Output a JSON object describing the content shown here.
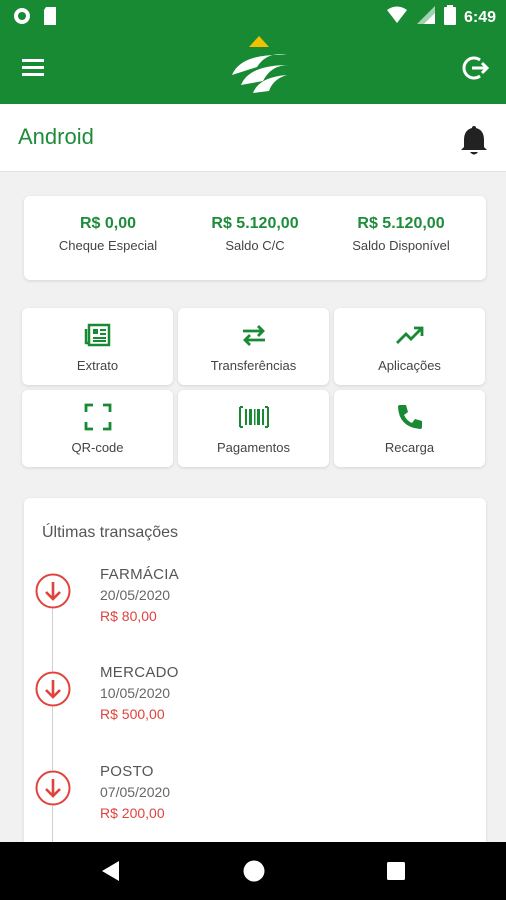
{
  "status_bar": {
    "time": "6:49",
    "icons": [
      "app-notification-icon",
      "sd-card-icon",
      "wifi-icon",
      "signal-icon",
      "battery-icon"
    ]
  },
  "app_bar": {
    "icons": [
      "menu-icon",
      "logo",
      "logout-icon"
    ]
  },
  "header": {
    "title": "Android",
    "icon": "bell-icon"
  },
  "balances": [
    {
      "amount": "R$ 0,00",
      "label": "Cheque Especial"
    },
    {
      "amount": "R$ 5.120,00",
      "label": "Saldo C/C"
    },
    {
      "amount": "R$ 5.120,00",
      "label": "Saldo Disponível"
    }
  ],
  "actions": [
    {
      "label": "Extrato",
      "icon": "statement-icon"
    },
    {
      "label": "Transferências",
      "icon": "transfer-icon"
    },
    {
      "label": "Aplicações",
      "icon": "trending-up-icon"
    },
    {
      "label": "QR-code",
      "icon": "qr-scan-icon"
    },
    {
      "label": "Pagamentos",
      "icon": "barcode-icon"
    },
    {
      "label": "Recarga",
      "icon": "phone-icon"
    }
  ],
  "transactions": {
    "title": "Últimas transações",
    "items": [
      {
        "name": "FARMÁCIA",
        "date": "20/05/2020",
        "amount": "R$ 80,00",
        "icon": "arrow-down-circle-icon"
      },
      {
        "name": "MERCADO",
        "date": "10/05/2020",
        "amount": "R$ 500,00",
        "icon": "arrow-down-circle-icon"
      },
      {
        "name": "POSTO",
        "date": "07/05/2020",
        "amount": "R$ 200,00",
        "icon": "arrow-down-circle-icon"
      }
    ]
  },
  "nav_bar": {
    "buttons": [
      "back-icon",
      "home-icon",
      "recents-icon"
    ]
  },
  "colors": {
    "brand_green": "#188a34",
    "text_green": "#1e8c3a",
    "debit_red": "#e0433d",
    "logo_gold": "#f2c200"
  }
}
